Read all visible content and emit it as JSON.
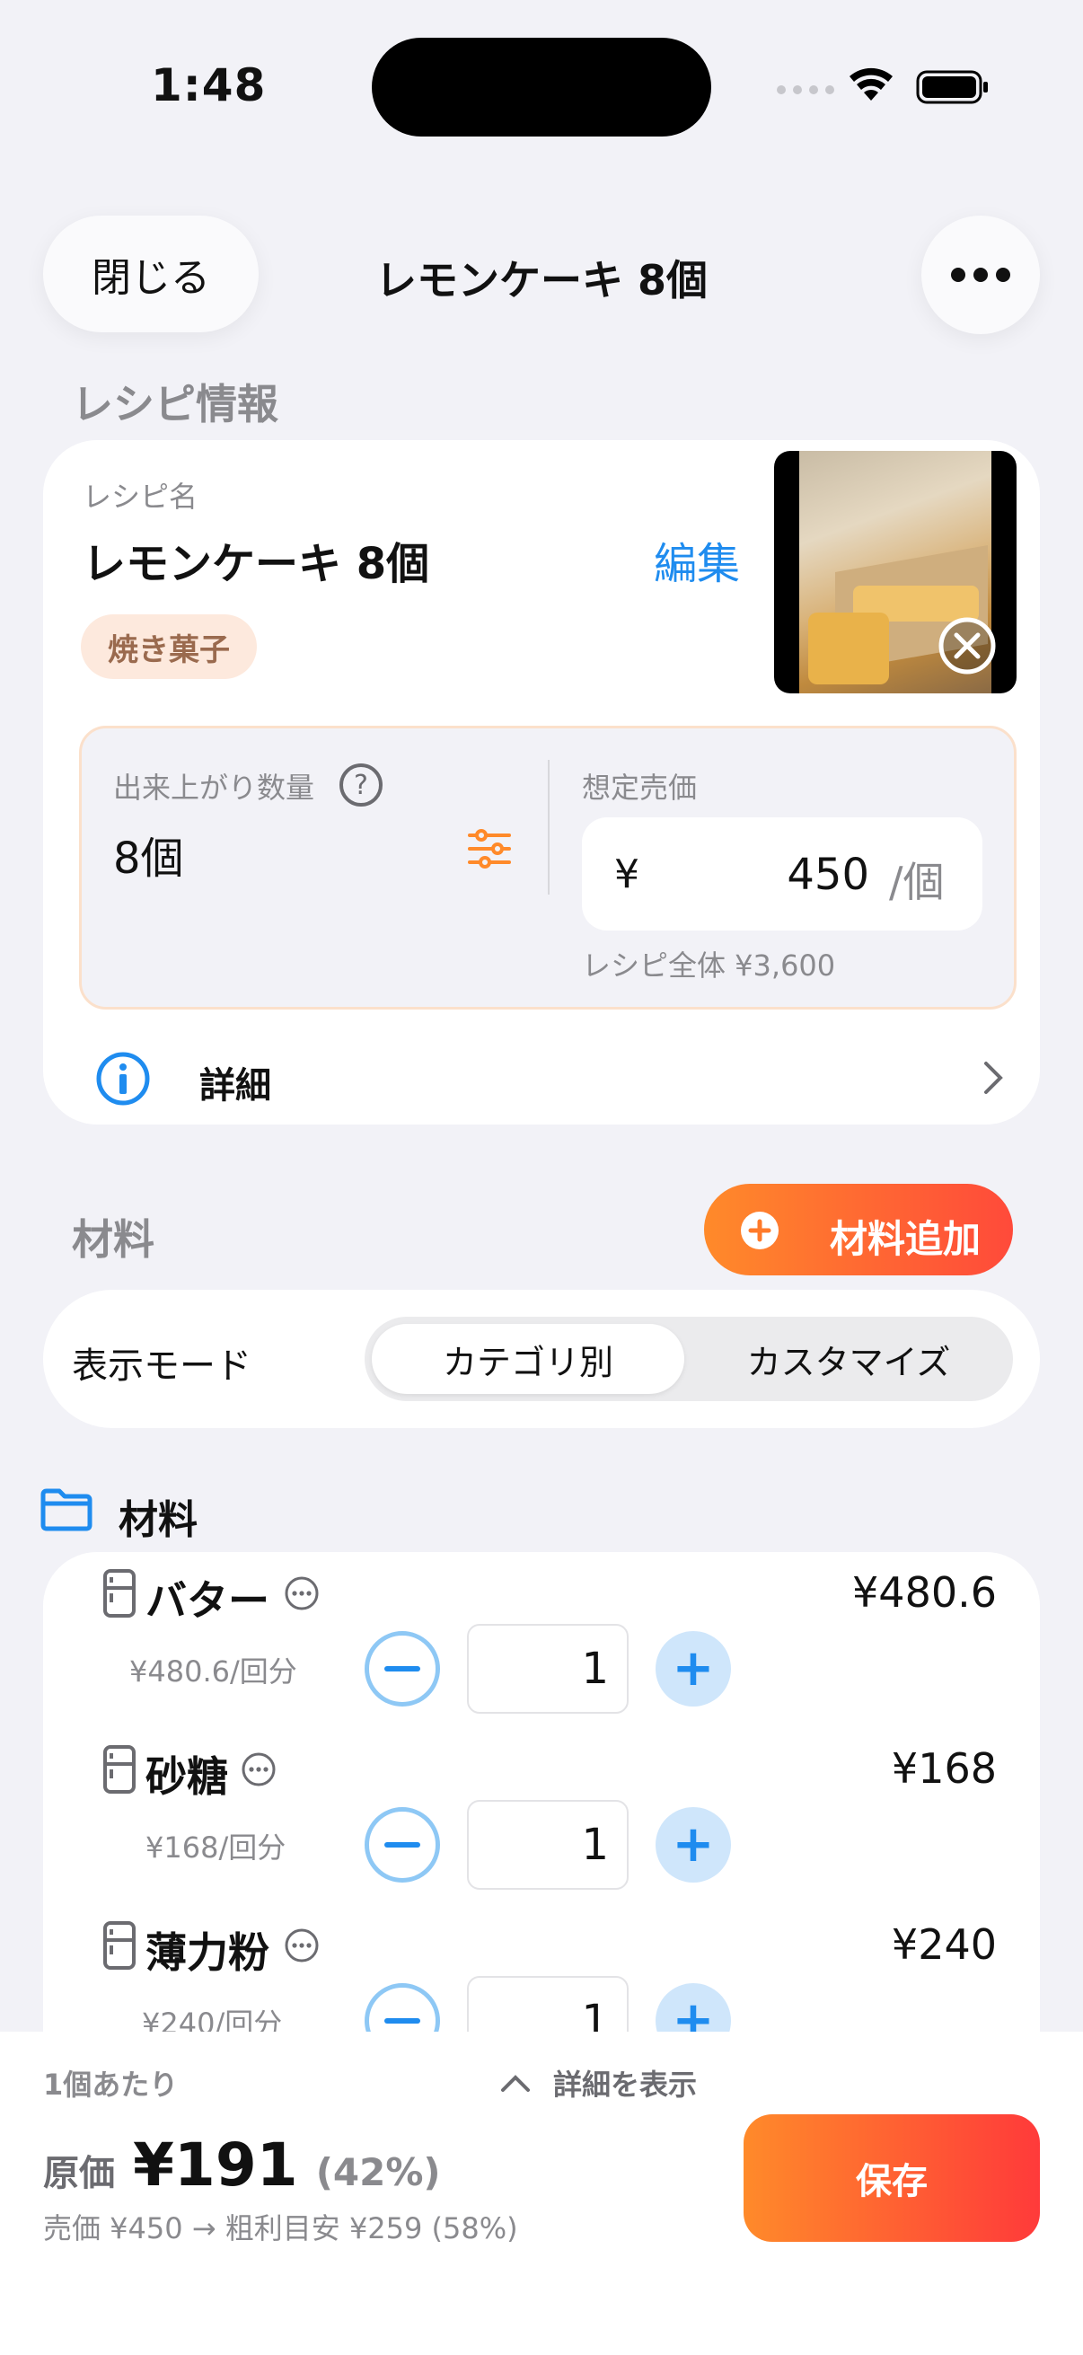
{
  "status_bar": {
    "time": "1:48"
  },
  "header": {
    "close_label": "閉じる",
    "title": "レモンケーキ 8個"
  },
  "recipe_info": {
    "section_title": "レシピ情報",
    "name_label": "レシピ名",
    "name": "レモンケーキ 8個",
    "edit_label": "編集",
    "tag": "焼き菓子",
    "yield_label": "出来上がり数量",
    "yield_value": "8個",
    "expected_price_label": "想定売価",
    "currency_symbol": "¥",
    "price_value": "450",
    "price_unit": "/個",
    "recipe_total": "レシピ全体 ¥3,600",
    "detail_label": "詳細"
  },
  "ingredients": {
    "section_title": "材料",
    "add_label": "材料追加",
    "display_mode_label": "表示モード",
    "modes": [
      "カテゴリ別",
      "カスタマイズ"
    ],
    "category_title": "材料",
    "items": [
      {
        "name": "バター",
        "price": "¥480.6",
        "unit_price": "¥480.6/回分",
        "qty": "1"
      },
      {
        "name": "砂糖",
        "price": "¥168",
        "unit_price": "¥168/回分",
        "qty": "1"
      },
      {
        "name": "薄力粉",
        "price": "¥240",
        "unit_price": "¥240/回分",
        "qty": "1"
      }
    ]
  },
  "summary": {
    "per_unit_label": "1個あたり",
    "show_detail_label": "詳細を表示",
    "cost_label": "原価",
    "cost_value": "¥191",
    "cost_pct": "(42%)",
    "margin_text": "売価 ¥450 → 粗利目安 ¥259 (58%)",
    "save_label": "保存"
  },
  "colors": {
    "accent_blue": "#1f8cef",
    "accent_orange": "#ff8a2a",
    "background": "#f2f2f7"
  }
}
